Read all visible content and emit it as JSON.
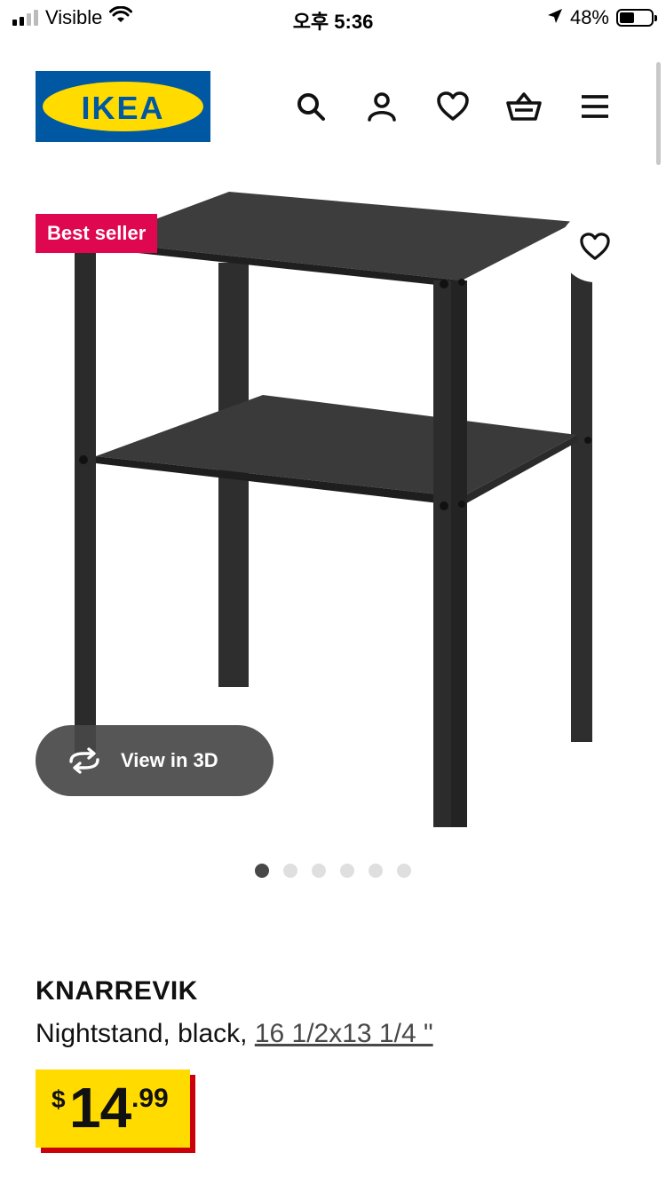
{
  "status_bar": {
    "carrier": "Visible",
    "time": "오후 5:36",
    "battery_percent": "48%",
    "battery_level": 0.48,
    "icons": [
      "signal-icon",
      "wifi-icon",
      "location-arrow-icon",
      "battery-icon"
    ]
  },
  "header": {
    "logo_text": "IKEA",
    "brand_colors": {
      "blue": "#0058a3",
      "yellow": "#ffdb00"
    },
    "icons": [
      "search-icon",
      "account-icon",
      "heart-icon",
      "basket-icon",
      "menu-icon"
    ]
  },
  "gallery": {
    "badge": "Best seller",
    "badge_color": "#e00751",
    "view_3d_label": "View in 3D",
    "image_count": 6,
    "active_image": 1
  },
  "product": {
    "name": "KNARREVIK",
    "description": "Nightstand, black,",
    "size": "16 1/2x13 1/4 \"",
    "price": {
      "currency": "$",
      "integer": "14",
      "decimal": ".99"
    },
    "price_colors": {
      "background": "#ffdb00",
      "shadow": "#cc0008"
    }
  }
}
